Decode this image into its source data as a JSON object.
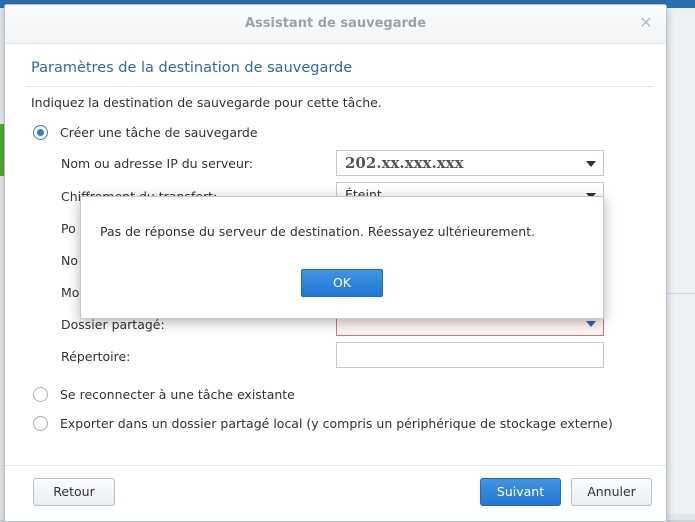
{
  "dialog": {
    "title": "Assistant de sauvegarde",
    "close_glyph": "✕",
    "section_title": "Paramètres de la destination de sauvegarde",
    "description": "Indiquez la destination de sauvegarde pour cette tâche."
  },
  "options": {
    "create": "Créer une tâche de sauvegarde",
    "reconnect": "Se reconnecter à une tâche existante",
    "export": "Exporter dans un dossier partagé local (y compris un périphérique de stockage externe)"
  },
  "fields": {
    "server_label": "Nom ou adresse IP du serveur:",
    "server_value": "202.xx.xxx.xxx",
    "encryption_label": "Chiffrement du transfert:",
    "encryption_value": "Éteint",
    "port_label": "Po",
    "name_label": "No",
    "password_label": "Mo",
    "shared_folder_label": "Dossier partagé:",
    "directory_label": "Répertoire:"
  },
  "buttons": {
    "back": "Retour",
    "next": "Suivant",
    "cancel": "Annuler"
  },
  "alert": {
    "message": "Pas de réponse du serveur de destination. Réessayez ultérieurement.",
    "ok": "OK"
  }
}
